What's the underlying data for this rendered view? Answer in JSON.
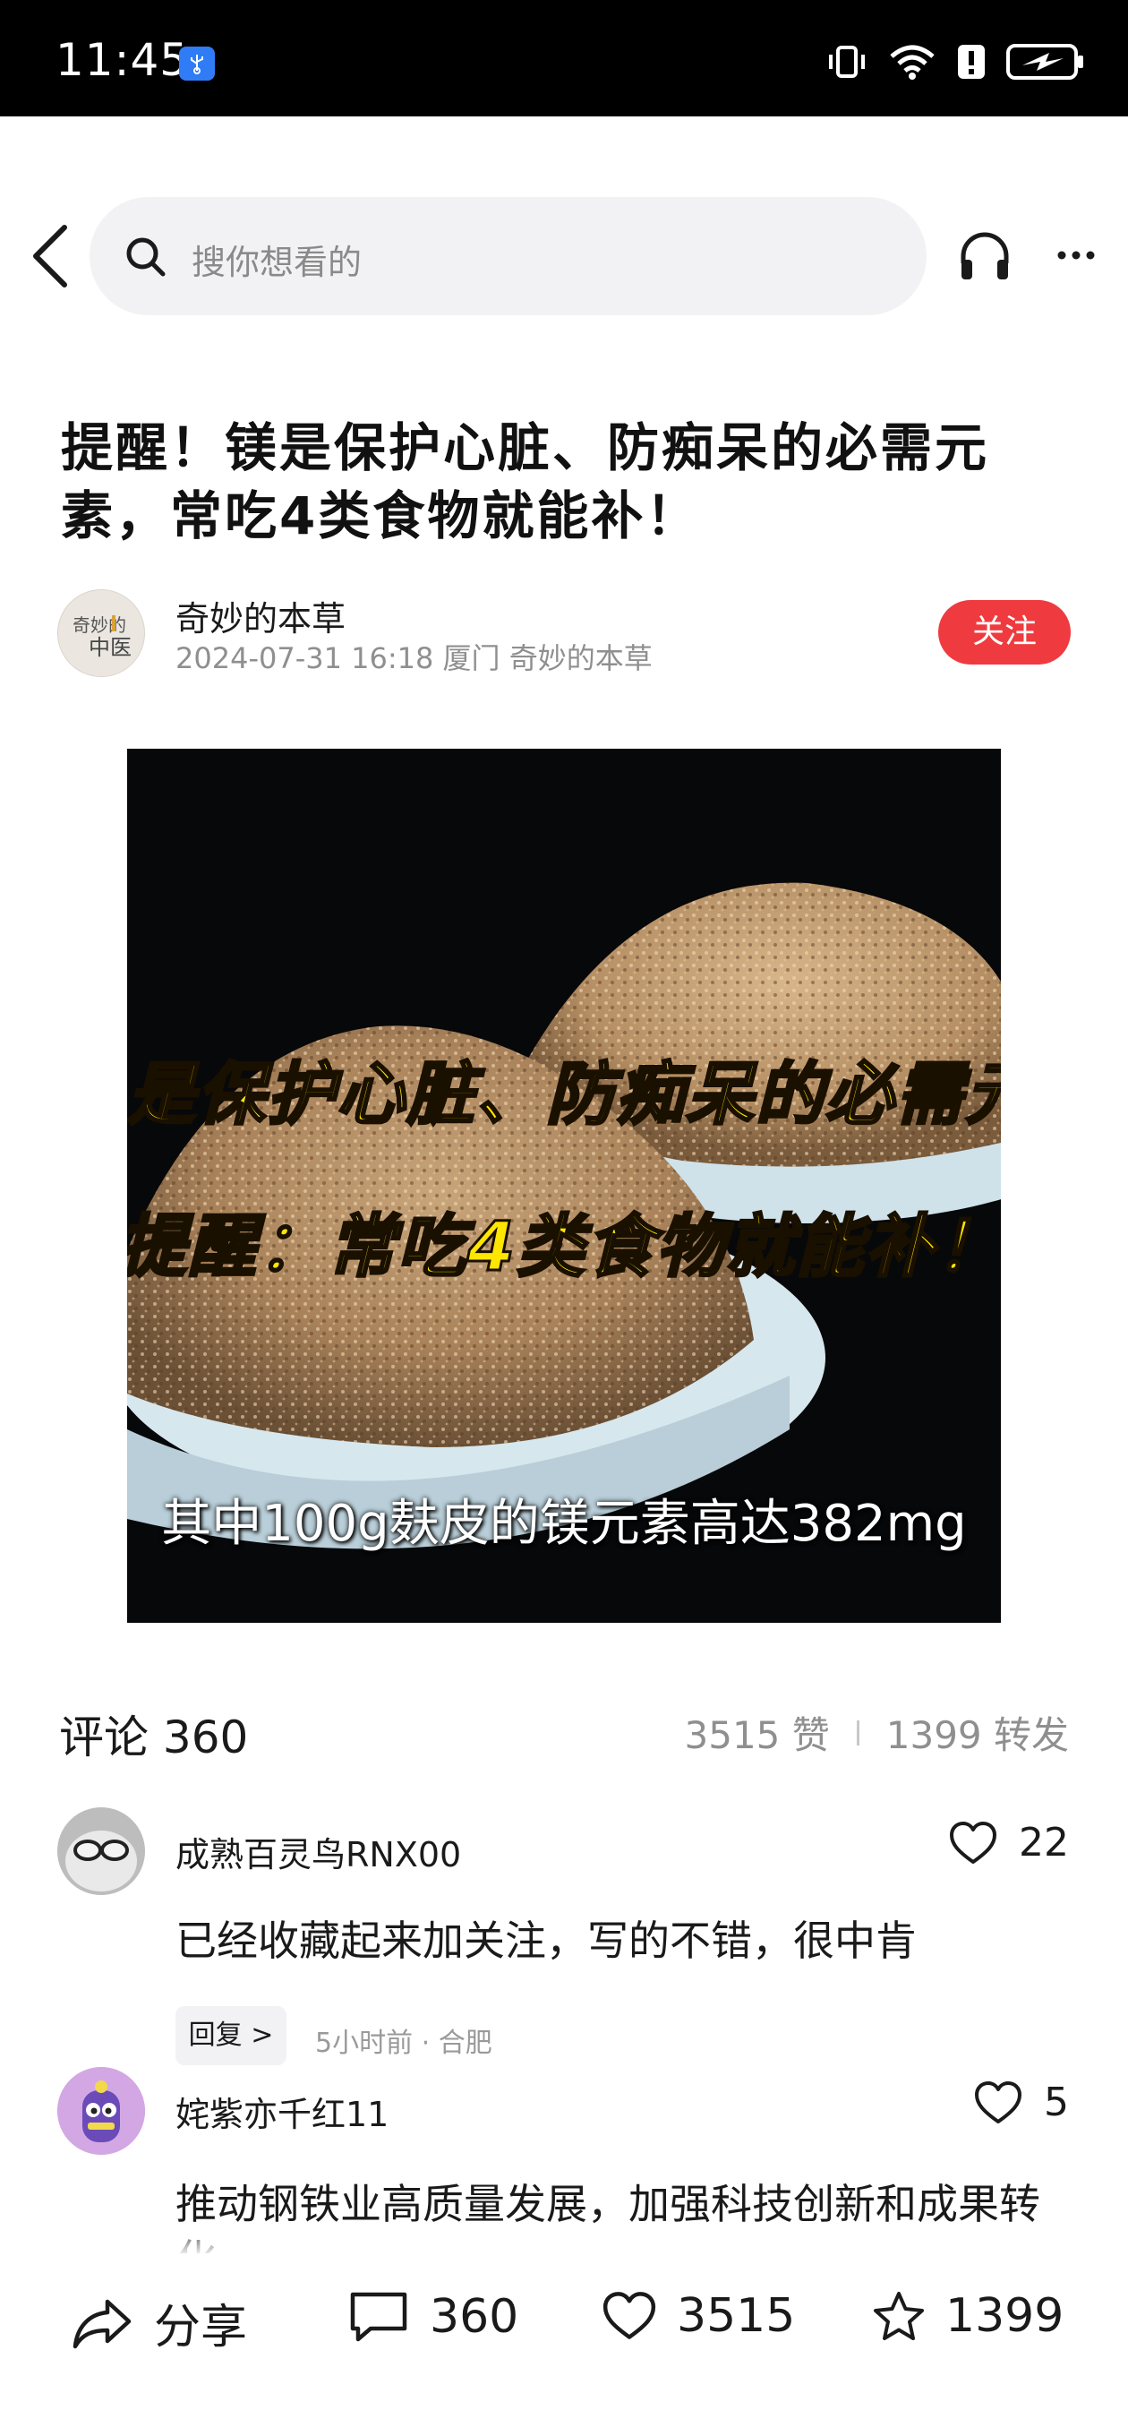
{
  "status_bar": {
    "time": "11:45"
  },
  "search": {
    "placeholder": "搜你想看的"
  },
  "article": {
    "title": "提醒！镁是保护心脏、防痴呆的必需元素，常吃4类食物就能补！",
    "author": {
      "name": "奇妙的本草",
      "meta": "2024-07-31 16:18 厦门 奇妙的本草",
      "avatar_text": "奇妙的中医",
      "follow_label": "关注"
    },
    "image": {
      "line1": "是保护心脏、防痴呆的必需元",
      "line2": "提醒：常吃4类食物就能补！",
      "caption": "其中100g麸皮的镁元素高达382mg"
    }
  },
  "comments_section": {
    "title": "评论 360",
    "likes_stat": "3515 赞",
    "reposts_stat": "1399 转发",
    "comments": [
      {
        "name": "成熟百灵鸟RNX00",
        "text": "已经收藏起来加关注，写的不错，很中肯",
        "likes": "22",
        "reply_label": "回复 >",
        "meta": "5小时前 · 合肥"
      },
      {
        "name": "姹紫亦千红11",
        "text": "推动钢铁业高质量发展，加强科技创新和成果转化",
        "likes": "5"
      }
    ]
  },
  "bottom_bar": {
    "share_label": "分享",
    "comment_count": "360",
    "like_count": "3515",
    "favorite_count": "1399"
  },
  "icons": [
    "usb-icon",
    "vibrate-icon",
    "wifi-icon",
    "alert-icon",
    "battery-icon",
    "back-icon",
    "search-icon",
    "headphones-icon",
    "more-icon",
    "heart-icon",
    "share-icon",
    "comment-icon",
    "star-icon"
  ],
  "colors": {
    "follow": "#ef3b3f",
    "status_bar": "#000000",
    "usb_badge": "#2f7cf6"
  }
}
